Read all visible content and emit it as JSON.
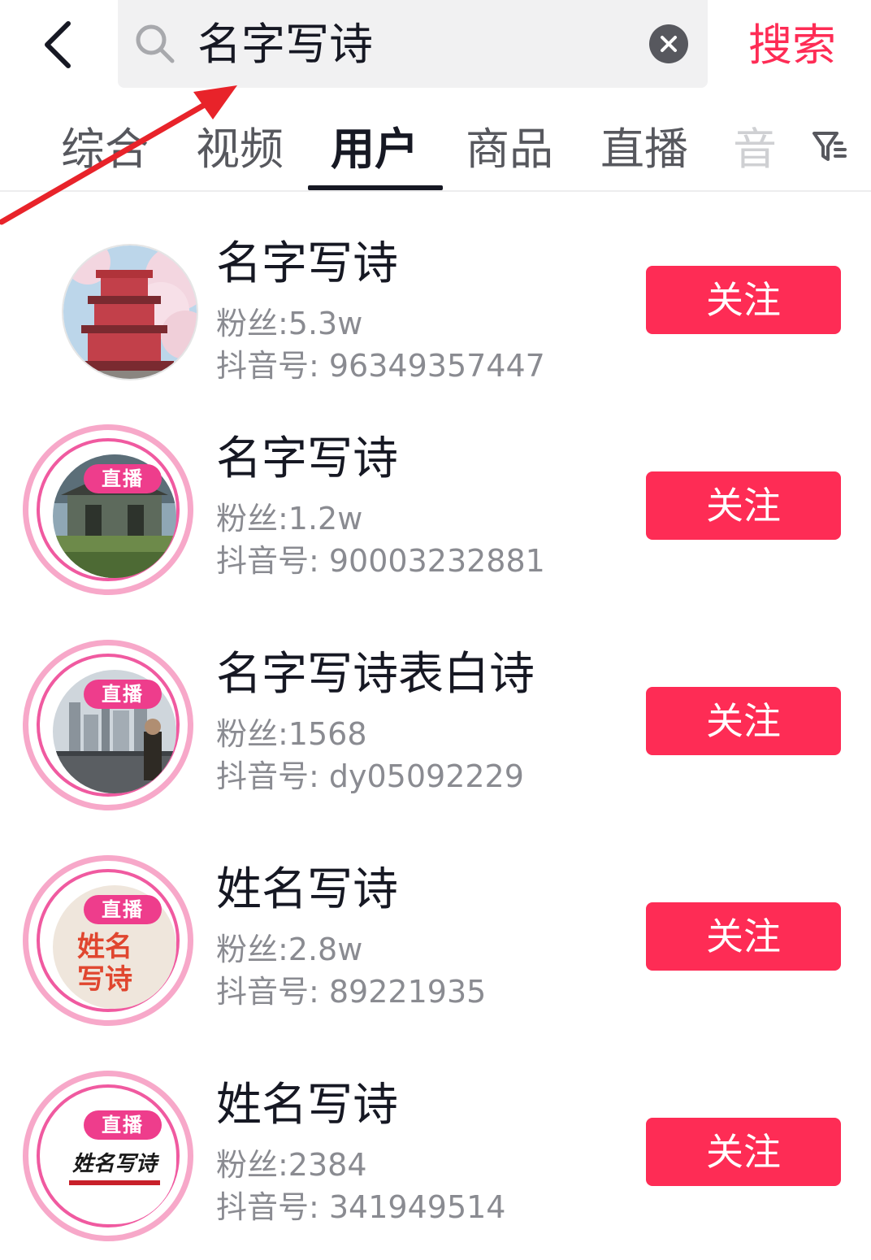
{
  "search": {
    "query": "名字写诗",
    "submit_label": "搜索"
  },
  "tabs": [
    {
      "label": "综合"
    },
    {
      "label": "视频"
    },
    {
      "label": "用户"
    },
    {
      "label": "商品"
    },
    {
      "label": "直播"
    },
    {
      "label": "音"
    }
  ],
  "active_tab": "用户",
  "users": [
    {
      "name": "名字写诗",
      "fans": "粉丝:5.3w",
      "douyin_id": "抖音号: 96349357447",
      "follow_label": "关注",
      "live": false
    },
    {
      "name": "名字写诗",
      "fans": "粉丝:1.2w",
      "douyin_id": "抖音号: 90003232881",
      "follow_label": "关注",
      "live": true,
      "live_badge": "直播"
    },
    {
      "name": "名字写诗表白诗",
      "fans": "粉丝:1568",
      "douyin_id": "抖音号: dy05092229",
      "follow_label": "关注",
      "live": true,
      "live_badge": "直播"
    },
    {
      "name": "姓名写诗",
      "fans": "粉丝:2.8w",
      "douyin_id": "抖音号: 89221935",
      "follow_label": "关注",
      "live": true,
      "live_badge": "直播",
      "avatar_text": [
        "姓名",
        "写诗"
      ]
    },
    {
      "name": "姓名写诗",
      "fans": "粉丝:2384",
      "douyin_id": "抖音号: 341949514",
      "follow_label": "关注",
      "live": true,
      "live_badge": "直播",
      "avatar_text": [
        "姓名写诗"
      ]
    }
  ],
  "colors": {
    "accent": "#fe2c55",
    "live_pink": "#ee3d8c",
    "annotation_red": "#e8232a"
  }
}
